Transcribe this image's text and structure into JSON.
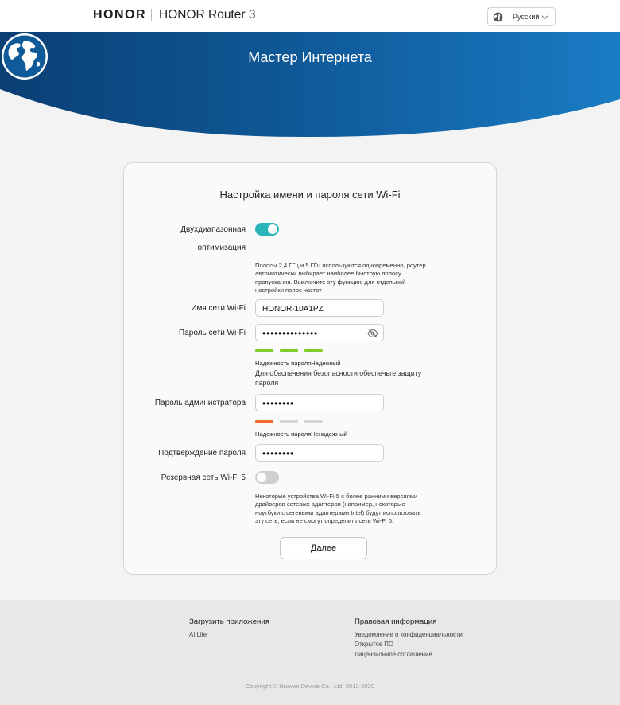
{
  "header": {
    "brand": "HONOR",
    "product": "HONOR Router 3",
    "language": "Русский"
  },
  "hero": {
    "title": "Мастер Интернета"
  },
  "form": {
    "title": "Настройка имени и пароля сети Wi-Fi",
    "dual_band": {
      "label_line1": "Двухдиапазонная",
      "label_line2": "оптимизация",
      "enabled": true,
      "note_lines": [
        "Полосы 2,4 ГГц и 5 ГГц используются одновременно, роутер",
        "автоматически выбирает наиболее быструю полосу",
        "пропускания. Выключите эту функцию для отдельной",
        "настройки полос частот"
      ]
    },
    "wifi_name": {
      "label": "Имя сети Wi-Fi",
      "value": "HONOR-10A1PZ"
    },
    "wifi_password": {
      "label": "Пароль сети Wi-Fi",
      "value": "••••••••••••••",
      "strength_label": "Надежность пароляНадежный",
      "strength_level": 3,
      "hint_lines": [
        "Для обеспечения безопасности обеспечьте защиту",
        "пароля"
      ]
    },
    "admin_password": {
      "label": "Пароль администратора",
      "value": "••••••••",
      "strength_label": "Надежность пароляНенадежный",
      "strength_level": 1
    },
    "confirm_password": {
      "label": "Подтверждение пароля",
      "value": "••••••••"
    },
    "backup_wifi5": {
      "label": "Резервная сеть Wi-Fi 5",
      "enabled": false,
      "note_lines": [
        "Некоторые устройства Wi-Fi 5 с более ранними версиями",
        "драйверов сетевых адаптеров (например, некоторые",
        "ноутбуки с сетевыми адаптерами Intel) будут использовать",
        "эту сеть, если не смогут определить сеть Wi-Fi 6."
      ]
    },
    "next_label": "Далее"
  },
  "footer": {
    "apps_heading": "Загрузить приложения",
    "apps_links": [
      "AI Life"
    ],
    "legal_heading": "Правовая информация",
    "legal_links": [
      "Уведомление о конфиденциальности",
      "Открытое ПО",
      "Лицензионное соглашение"
    ],
    "copyright": "Copyright © Huawei Device Co., Ltd. 2012-2020"
  },
  "colors": {
    "hero_dark": "#0a4a82",
    "hero_light": "#1a78c2",
    "toggle_on": "#2ab5b8",
    "strength_strong": "#7fcb2a",
    "strength_weak": "#ee6b2a"
  },
  "icons": {
    "language": "globe-icon",
    "language_dropdown": "chevron-down-icon",
    "hero": "globe-icon",
    "password_visibility": "eye-off-icon"
  }
}
